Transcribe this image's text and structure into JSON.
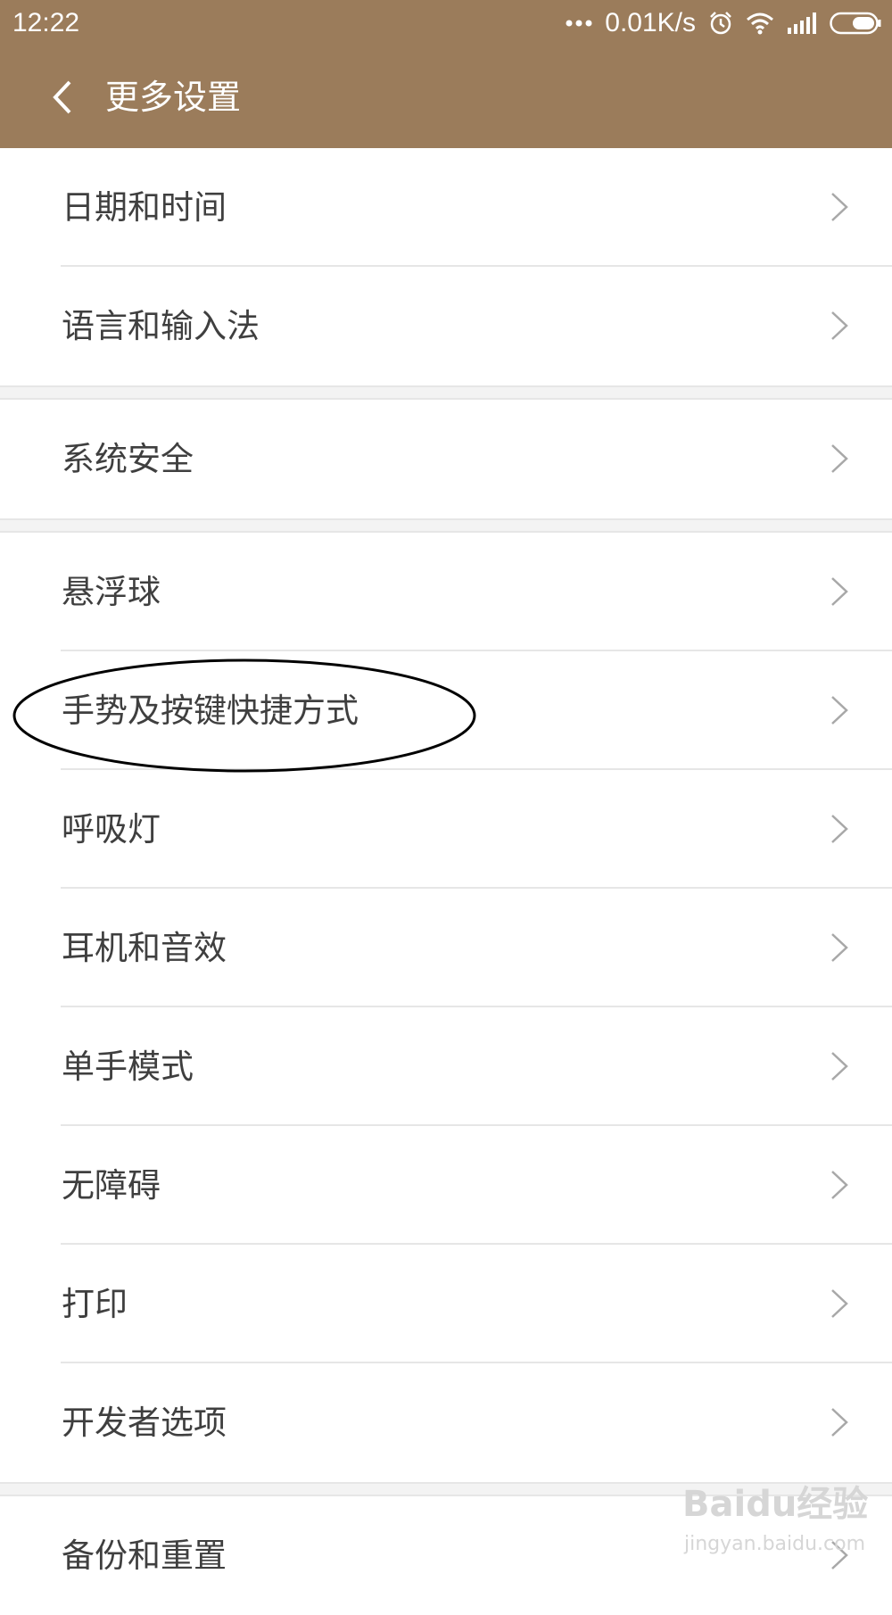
{
  "status_bar": {
    "time": "12:22",
    "network_speed": "0.01K/s",
    "icons": [
      "more-dots-icon",
      "alarm-icon",
      "wifi-icon",
      "signal-icon",
      "battery-icon"
    ]
  },
  "header": {
    "title": "更多设置",
    "back_icon": "chevron-left-icon",
    "background": "#9b7c5b"
  },
  "sections": [
    {
      "items": [
        {
          "label": "日期和时间"
        },
        {
          "label": "语言和输入法"
        }
      ]
    },
    {
      "items": [
        {
          "label": "系统安全"
        }
      ]
    },
    {
      "items": [
        {
          "label": "悬浮球"
        },
        {
          "label": "手势及按键快捷方式",
          "circled": true
        },
        {
          "label": "呼吸灯"
        },
        {
          "label": "耳机和音效"
        },
        {
          "label": "单手模式"
        },
        {
          "label": "无障碍"
        },
        {
          "label": "打印"
        },
        {
          "label": "开发者选项"
        }
      ]
    },
    {
      "items": [
        {
          "label": "备份和重置"
        }
      ]
    }
  ],
  "item_icon": "chevron-right-icon",
  "watermark": {
    "logo": "Baidu经验",
    "url": "jingyan.baidu.com"
  }
}
